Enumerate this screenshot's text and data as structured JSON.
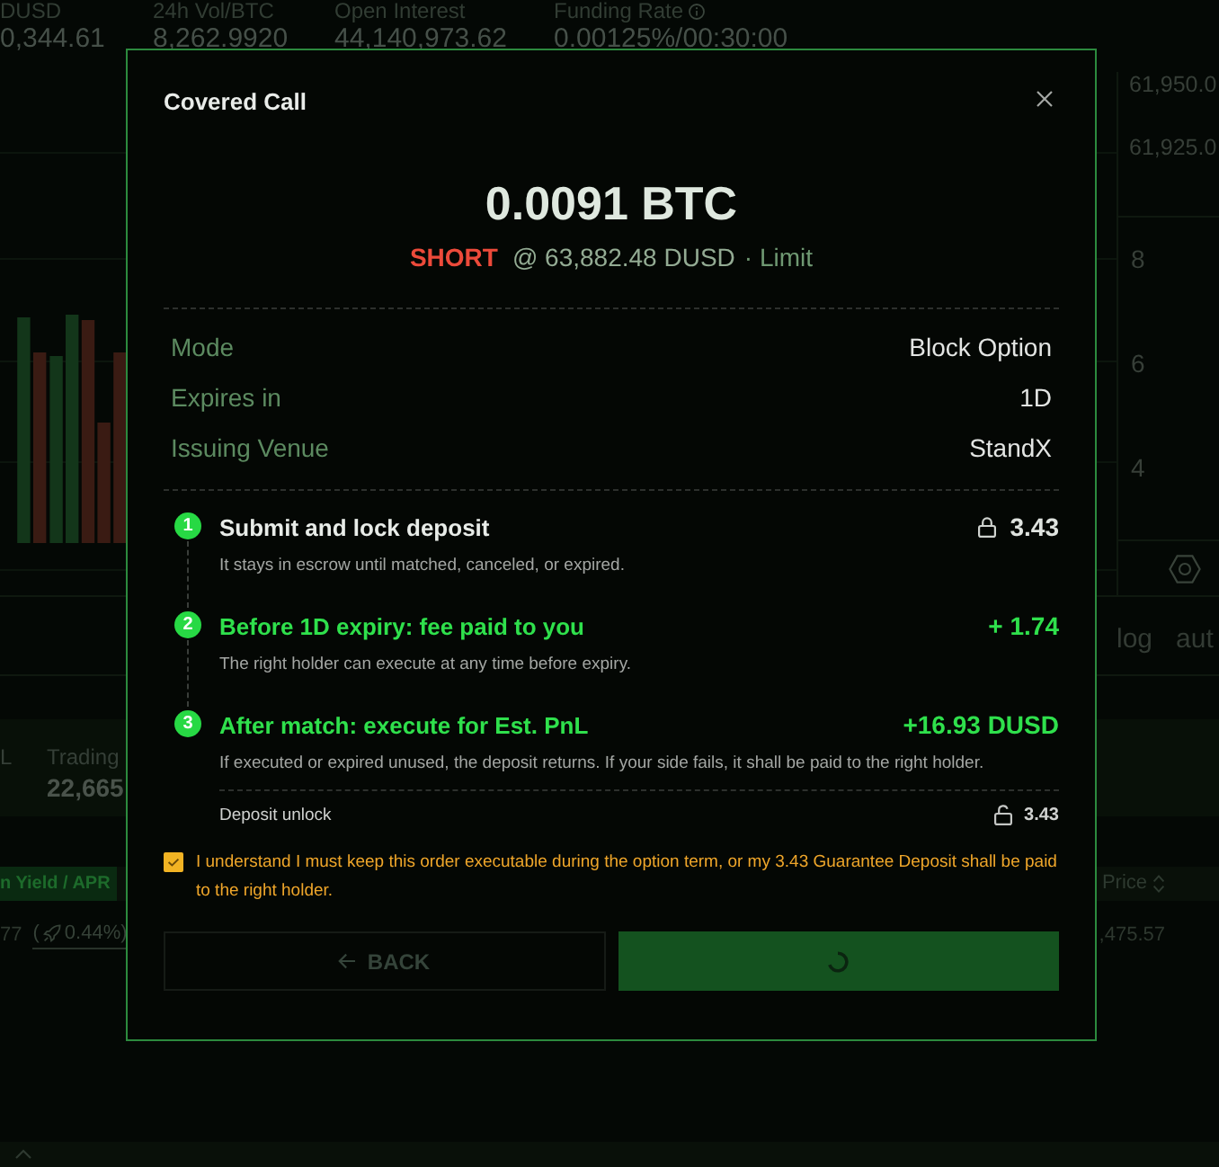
{
  "market_stats": [
    {
      "label": "DUSD",
      "value": "0,344.61",
      "info": false
    },
    {
      "label": "24h Vol/BTC",
      "value": "8,262.9920",
      "info": false
    },
    {
      "label": "Open Interest",
      "value": "44,140,973.62",
      "info": false
    },
    {
      "label": "Funding Rate",
      "value": "0.00125%/00:30:00",
      "info": true
    }
  ],
  "price_scale": {
    "prices": [
      "61,950.0",
      "61,925.0"
    ],
    "volumes": [
      "8",
      "6",
      "4"
    ]
  },
  "chart_toggles": [
    "log",
    "aut"
  ],
  "account_summary": [
    {
      "label": "L"
    },
    {
      "label": "Trading",
      "value": "22,665"
    }
  ],
  "positions_table": {
    "columns": [
      {
        "label": "n Yield / APR",
        "kind": "badge"
      },
      {
        "label": "Price",
        "kind": "sortable"
      }
    ],
    "row": {
      "cell_1": "77",
      "rebate": {
        "open": "(",
        "value": "0.44%)"
      },
      "price": ",475.57"
    }
  },
  "dialog": {
    "title": "Covered Call",
    "amount": "0.0091 BTC",
    "side": {
      "label": "SHORT",
      "kind": "short"
    },
    "price": "@ 63,882.48 DUSD",
    "order_type": "· Limit",
    "details": [
      {
        "label": "Mode",
        "value": "Block Option"
      },
      {
        "label": "Expires in",
        "value": "1D"
      },
      {
        "label": "Issuing Venue",
        "value": "StandX"
      }
    ],
    "steps": [
      {
        "number": "1",
        "kind": "lock",
        "title": "Submit and lock deposit",
        "amount": "3.43",
        "description": "It stays in escrow until matched, canceled, or expired."
      },
      {
        "number": "2",
        "kind": "gain",
        "title": "Before 1D expiry: fee paid to you",
        "amount": "+ 1.74",
        "description": "The right holder can execute at any time before expiry."
      },
      {
        "number": "3",
        "kind": "gain",
        "title": "After match: execute for Est. PnL",
        "amount": "+16.93 DUSD",
        "description": "If executed or expired unused, the deposit returns. If your side fails, it shall be paid to the right holder."
      }
    ],
    "deposit_unlock": {
      "label": "Deposit unlock",
      "amount": "3.43"
    },
    "acknowledgement": {
      "checked": true,
      "text": "I understand I must keep this order executable during the option term, or my 3.43 Guarantee Deposit shall be paid to the right holder."
    },
    "back_button": {
      "label": "BACK",
      "disabled": true
    },
    "confirm_button": {
      "loading": true
    }
  }
}
